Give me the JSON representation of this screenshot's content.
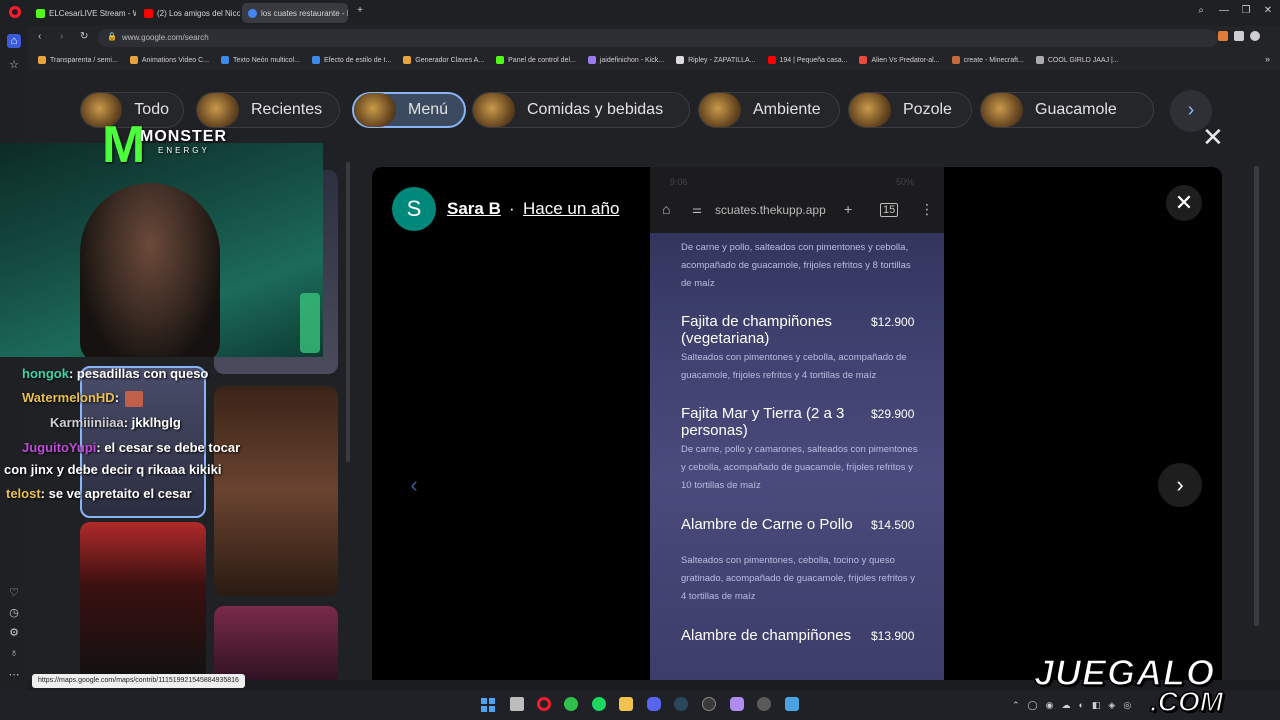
{
  "tabs": [
    {
      "title": "ELCesarLIVE Stream - Wat",
      "color": "#53fc18"
    },
    {
      "title": "(2) Los amigos del Nico #",
      "color": "#ff0000"
    },
    {
      "title": "los cuates restaurante - B",
      "color": "#4285f4"
    }
  ],
  "address": {
    "url": "www.google.com/search"
  },
  "bookmarks": [
    {
      "label": "Transparenta / semi...",
      "color": "#e8a33d"
    },
    {
      "label": "Animations Video C...",
      "color": "#e8a33d"
    },
    {
      "label": "Texto Neón multicol...",
      "color": "#3d8ae8"
    },
    {
      "label": "Efecto de estilo de t...",
      "color": "#3d8ae8"
    },
    {
      "label": "Generador Claves A...",
      "color": "#e8a33d"
    },
    {
      "label": "Panel de control del...",
      "color": "#53fc18"
    },
    {
      "label": "jaidefinichon - Kick...",
      "color": "#9a7cf0"
    },
    {
      "label": "Ripley - ZAPATILLA...",
      "color": "#dddddd"
    },
    {
      "label": "194 | Pequeña casa...",
      "color": "#ff0000"
    },
    {
      "label": "Alien Vs Predator-al...",
      "color": "#e84a3d"
    },
    {
      "label": "create - Minecraft...",
      "color": "#c46b3d"
    },
    {
      "label": "COOL GIRLD JAAJ |...",
      "color": "#aaaaaa"
    }
  ],
  "chips": [
    {
      "label": "Todo"
    },
    {
      "label": "Recientes"
    },
    {
      "label": "Menú"
    },
    {
      "label": "Comidas y bebidas"
    },
    {
      "label": "Ambiente"
    },
    {
      "label": "Pozole"
    },
    {
      "label": "Guacamole"
    }
  ],
  "review": {
    "avatar_letter": "S",
    "author": "Sara B",
    "separator": "·",
    "time_ago": "Hace un año"
  },
  "phone": {
    "status_time": "9:06",
    "status_right": "50%",
    "url": "scuates.thekupp.app"
  },
  "menu": {
    "top_desc": "De carne y pollo, salteados con pimentones y cebolla, acompañado de guacamole, frijoles refritos y 8 tortillas de maíz",
    "items": [
      {
        "name": "Fajita de champiñones (vegetariana)",
        "price": "$12.900",
        "desc": "Salteados con pimentones y cebolla, acompañado de guacamole, frijoles refritos y 4 tortillas de maíz"
      },
      {
        "name": "Fajita Mar y Tierra (2 a 3 personas)",
        "price": "$29.900",
        "desc": "De carne, pollo y camarones, salteados con pimentones y cebolla, acompañado de guacamole, frijoles refritos y 10 tortillas de maíz"
      },
      {
        "name": "Alambre de Carne o Pollo",
        "price": "$14.500",
        "desc": "Salteados con pimentones, cebolla, tocino y queso gratinado, acompañado de guacamole, frijoles refritos y 4 tortillas de maíz"
      },
      {
        "name": "Alambre de champiñones",
        "price": "$13.900",
        "desc": ""
      }
    ]
  },
  "chat": [
    {
      "user": "hongok",
      "text": ": pesadillas con queso",
      "color": "#3dd6a3"
    },
    {
      "user": "WatermelonHD",
      "text": ":",
      "color": "#e8c04a"
    },
    {
      "user": "Karmiiiniiaa",
      "text": ": jkklhglg",
      "color": "#cfcfcf"
    },
    {
      "user": "JuguitoYupi",
      "text": ": el cesar se debe tocar",
      "color": "#c04ad8"
    },
    {
      "user": "",
      "text": "con jinx y debe decir q rikaaa kikiki",
      "color": "#ffffff"
    },
    {
      "user": "telost",
      "text": ": se ve apretaito el cesar",
      "color": "#e8c04a"
    }
  ],
  "overlay_logo": {
    "brand": "MONSTER",
    "sub": "ENERGY"
  },
  "status_url": "https://maps.google.com/maps/contrib/111519921545884935816",
  "watermark": {
    "line1": "JUEGALO",
    "line2": ".COM"
  },
  "icons": [
    "search-icon",
    "minimize-icon",
    "maximize-icon",
    "close-icon",
    "home-icon",
    "heart-icon",
    "clock-icon",
    "gear-icon",
    "bulb-icon"
  ]
}
